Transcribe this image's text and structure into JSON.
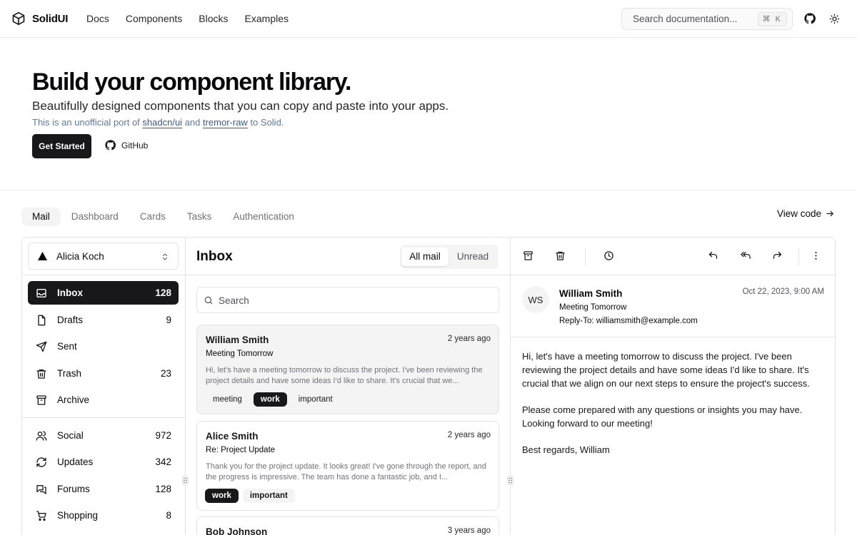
{
  "header": {
    "brand": "SolidUI",
    "nav": [
      "Docs",
      "Components",
      "Blocks",
      "Examples"
    ],
    "search_placeholder": "Search documentation...",
    "search_shortcut": "⌘ K"
  },
  "hero": {
    "title": "Build your component library.",
    "subtitle": "Beautifully designed components that you can copy and paste into your apps.",
    "note_prefix": "This is an unofficial port of ",
    "link1": "shadcn/ui",
    "note_and": " and ",
    "link2": "tremor-raw",
    "note_suffix": " to Solid.",
    "cta_primary": "Get Started",
    "cta_secondary": "GitHub"
  },
  "demo_tabs": [
    "Mail",
    "Dashboard",
    "Cards",
    "Tasks",
    "Authentication"
  ],
  "active_demo_tab": "Mail",
  "view_code": "View code",
  "sidebar": {
    "account": "Alicia Koch",
    "primary": [
      {
        "label": "Inbox",
        "count": "128",
        "icon": "inbox-icon",
        "active": true
      },
      {
        "label": "Drafts",
        "count": "9",
        "icon": "file-icon"
      },
      {
        "label": "Sent",
        "count": "",
        "icon": "send-icon"
      },
      {
        "label": "Trash",
        "count": "23",
        "icon": "trash-icon"
      },
      {
        "label": "Archive",
        "count": "",
        "icon": "archive-icon"
      }
    ],
    "secondary": [
      {
        "label": "Social",
        "count": "972",
        "icon": "users-icon"
      },
      {
        "label": "Updates",
        "count": "342",
        "icon": "updates-icon"
      },
      {
        "label": "Forums",
        "count": "128",
        "icon": "forums-icon"
      },
      {
        "label": "Shopping",
        "count": "8",
        "icon": "cart-icon"
      }
    ]
  },
  "inbox": {
    "title": "Inbox",
    "filter_all": "All mail",
    "filter_unread": "Unread",
    "search_placeholder": "Search",
    "messages": [
      {
        "from": "William Smith",
        "date": "2 years ago",
        "subject": "Meeting Tomorrow",
        "preview": "Hi, let's have a meeting tomorrow to discuss the project. I've been reviewing the project details and have some ideas I'd like to share. It's crucial that we...",
        "tags": [
          "meeting",
          "work",
          "important"
        ],
        "tag_styles": [
          "plain",
          "dark",
          "plain"
        ]
      },
      {
        "from": "Alice Smith",
        "date": "2 years ago",
        "subject": "Re: Project Update",
        "preview": "Thank you for the project update. It looks great! I've gone through the report, and the progress is impressive. The team has done a fantastic job, and I...",
        "tags": [
          "work",
          "important"
        ],
        "tag_styles": [
          "dark",
          "grey"
        ]
      },
      {
        "from": "Bob Johnson",
        "date": "3 years ago"
      }
    ]
  },
  "detail": {
    "initials": "WS",
    "from": "William Smith",
    "subject": "Meeting Tomorrow",
    "reply_to": "Reply-To: williamsmith@example.com",
    "date": "Oct 22, 2023, 9:00 AM",
    "body": [
      "Hi, let's have a meeting tomorrow to discuss the project. I've been reviewing the project details and have some ideas I'd like to share. It's crucial that we align on our next steps to ensure the project's success.",
      "Please come prepared with any questions or insights you may have. Looking forward to our meeting!",
      "Best regards, William"
    ]
  }
}
